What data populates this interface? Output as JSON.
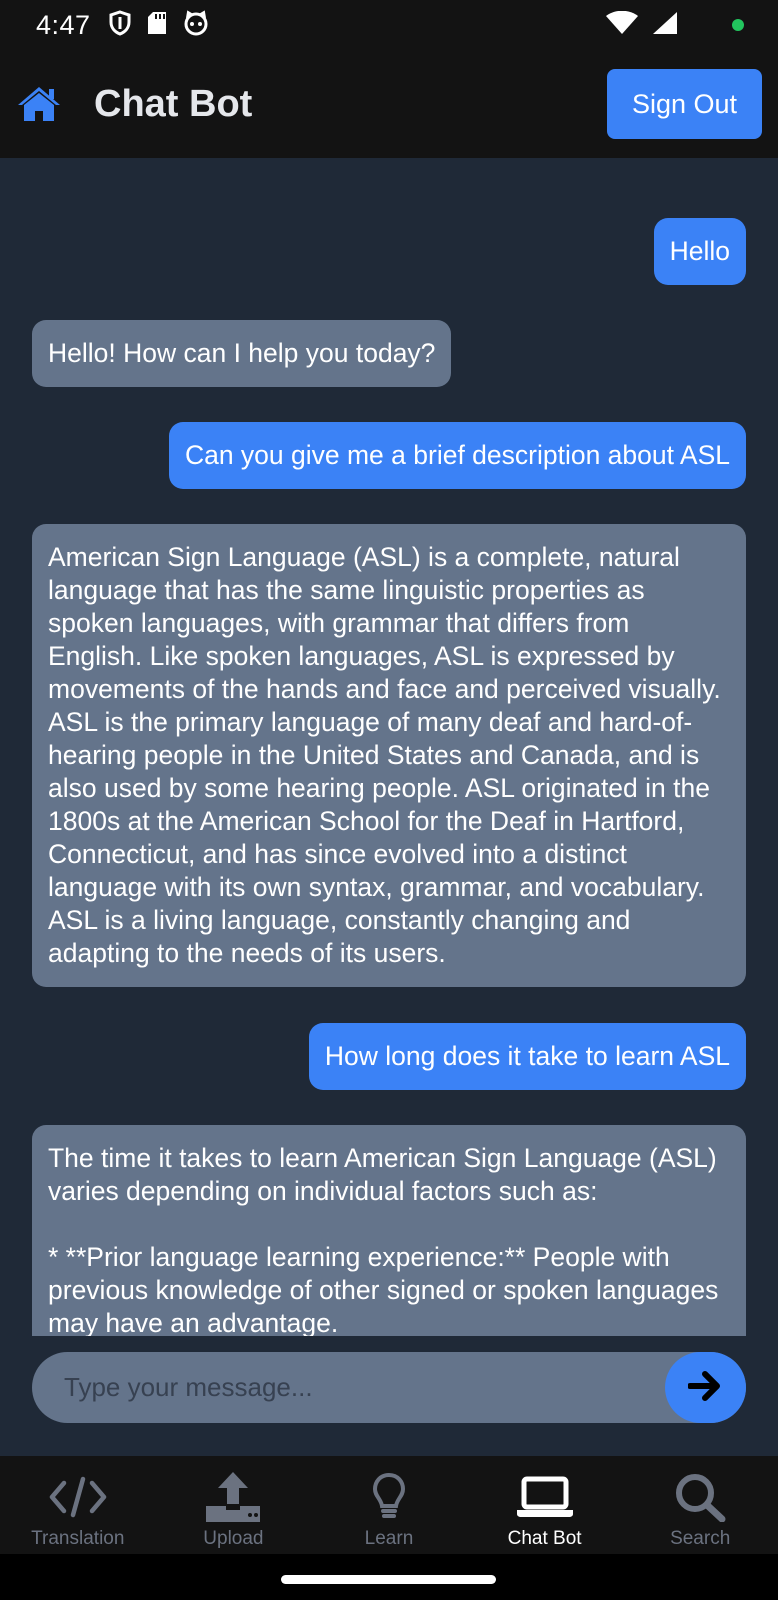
{
  "status_bar": {
    "time": "4:47"
  },
  "header": {
    "title": "Chat Bot",
    "sign_out_label": "Sign Out"
  },
  "messages": [
    {
      "role": "user",
      "text": "Hello"
    },
    {
      "role": "bot",
      "text": "Hello! How can I help you today?"
    },
    {
      "role": "user",
      "text": "Can you give me a brief description about ASL"
    },
    {
      "role": "bot",
      "text": "American Sign Language (ASL) is a complete, natural language that has the same linguistic properties as spoken languages, with grammar that differs from English. Like spoken languages, ASL is expressed by movements of the hands and face and perceived visually. ASL is the primary language of many deaf and hard-of-hearing people in the United States and Canada, and is also used by some hearing people. ASL originated in the 1800s at the American School for the Deaf in Hartford, Connecticut, and has since evolved into a distinct language with its own syntax, grammar, and vocabulary. ASL is a living language, constantly changing and adapting to the needs of its users."
    },
    {
      "role": "user",
      "text": "How long does it take to learn ASL"
    },
    {
      "role": "bot",
      "text": "The time it takes to learn American Sign Language (ASL) varies depending on individual factors such as:\n\n* **Prior language learning experience:** People with previous knowledge of other signed or spoken languages may have an advantage."
    }
  ],
  "composer": {
    "placeholder": "Type your message...",
    "value": ""
  },
  "nav": {
    "items": [
      {
        "label": "Translation",
        "icon": "code-icon",
        "active": false
      },
      {
        "label": "Upload",
        "icon": "upload-icon",
        "active": false
      },
      {
        "label": "Learn",
        "icon": "lightbulb-icon",
        "active": false
      },
      {
        "label": "Chat Bot",
        "icon": "laptop-icon",
        "active": true
      },
      {
        "label": "Search",
        "icon": "search-icon",
        "active": false
      }
    ]
  },
  "colors": {
    "accent": "#3b82f6",
    "bot_bubble": "#64748b",
    "background": "#1f2937",
    "bar": "#131313",
    "status_dot": "#22c55e"
  }
}
